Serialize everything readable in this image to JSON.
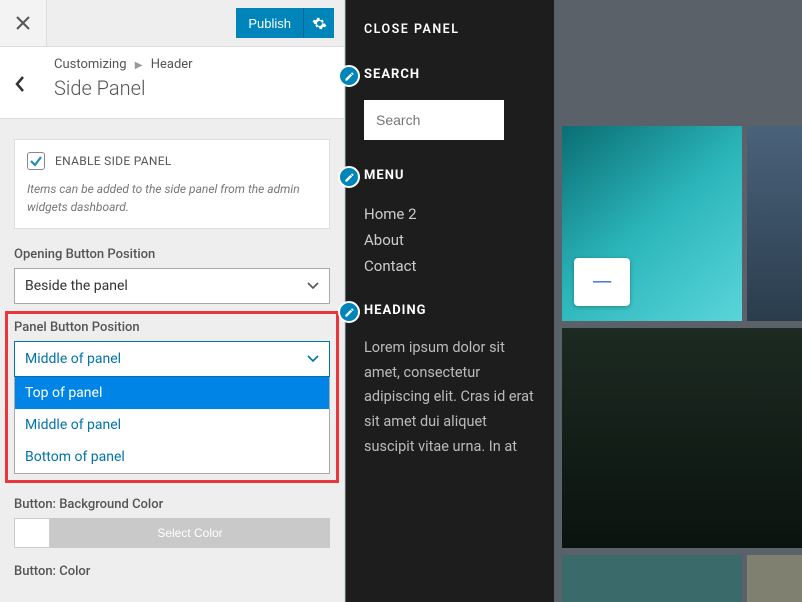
{
  "topbar": {
    "publish": "Publish"
  },
  "breadcrumb": {
    "root": "Customizing",
    "parent": "Header",
    "title": "Side Panel"
  },
  "enable": {
    "label": "ENABLE SIDE PANEL",
    "help": "Items can be added to the side panel from the admin widgets dashboard.",
    "checked": true
  },
  "opening_position": {
    "label": "Opening Button Position",
    "value": "Beside the panel"
  },
  "panel_position": {
    "label": "Panel Button Position",
    "value": "Middle of panel",
    "options": [
      "Top of panel",
      "Middle of panel",
      "Bottom of panel"
    ],
    "selected_index": 0
  },
  "button_bg": {
    "label": "Button: Background Color",
    "cta": "Select Color"
  },
  "button_color": {
    "label": "Button: Color"
  },
  "panel": {
    "close": "CLOSE PANEL",
    "search_head": "SEARCH",
    "search_placeholder": "Search",
    "menu_head": "MENU",
    "menu": [
      "Home 2",
      "About",
      "Contact"
    ],
    "heading_head": "HEADING",
    "lorem": "Lorem ipsum dolor sit amet, consectetur adipiscing elit. Cras id erat sit amet dui aliquet suscipit vitae urna. In at"
  },
  "minus": "—"
}
